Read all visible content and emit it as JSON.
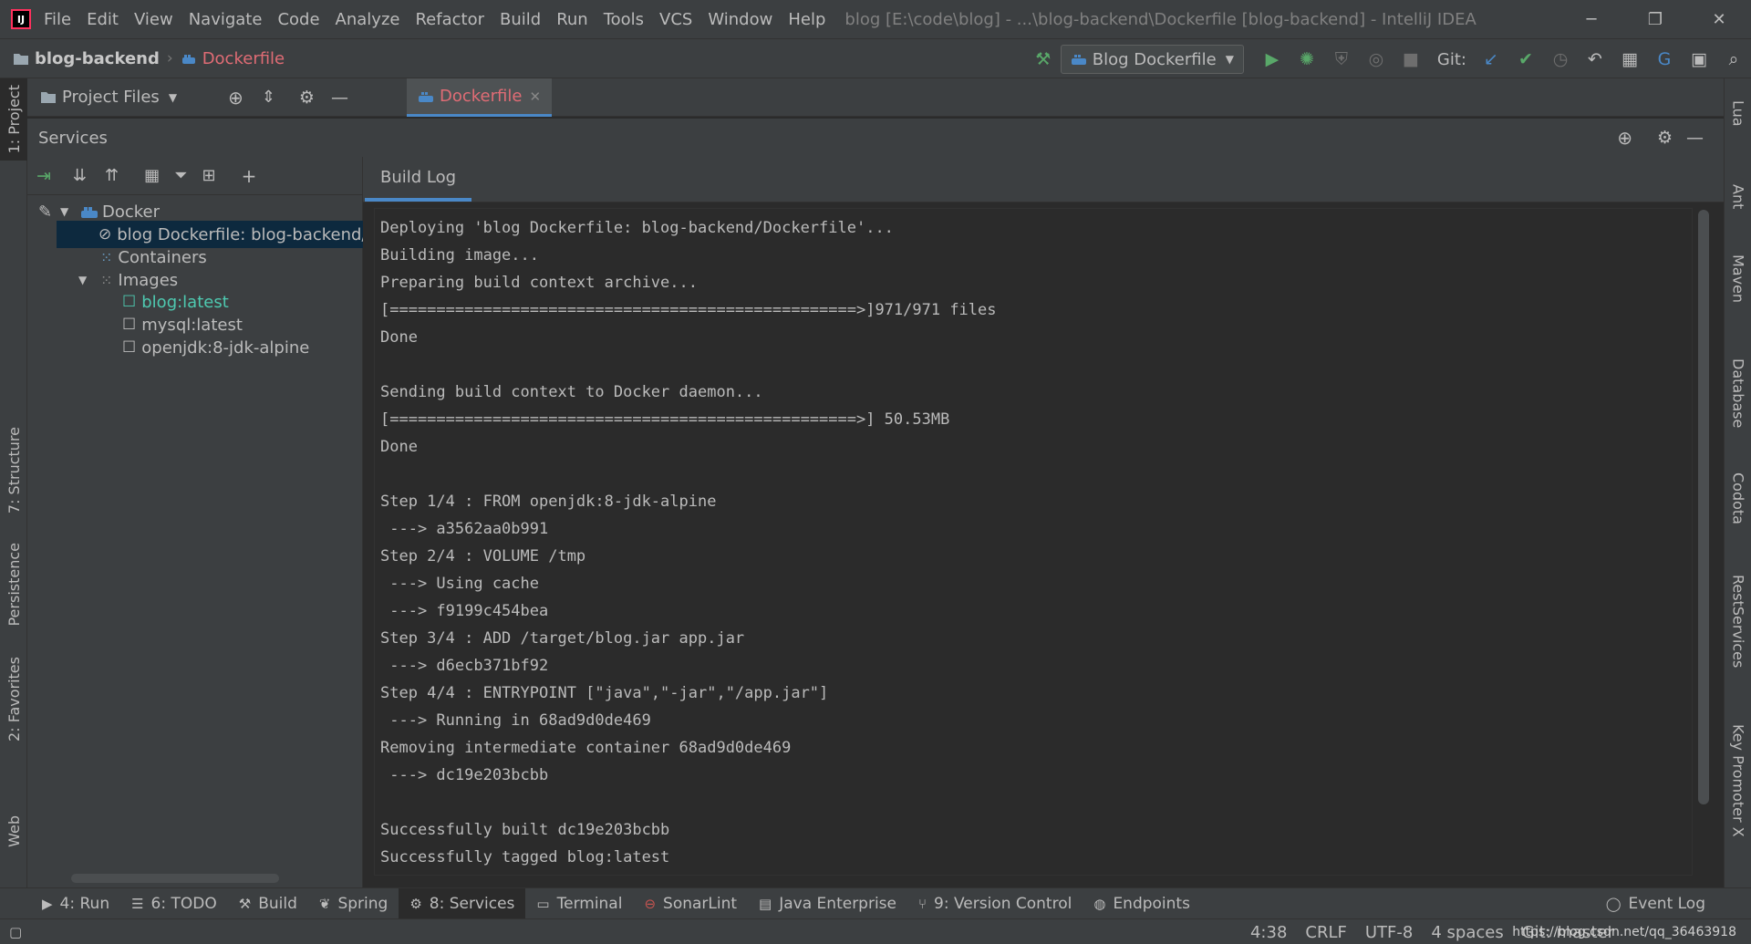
{
  "menubar": {
    "logo_text": "IJ",
    "items": [
      "File",
      "Edit",
      "View",
      "Navigate",
      "Code",
      "Analyze",
      "Refactor",
      "Build",
      "Run",
      "Tools",
      "VCS",
      "Window",
      "Help"
    ],
    "window_title": "blog [E:\\code\\blog] - ...\\blog-backend\\Dockerfile [blog-backend] - IntelliJ IDEA",
    "controls": [
      "─",
      "❐",
      "✕"
    ]
  },
  "navbar": {
    "project": "blog-backend",
    "file": "Dockerfile",
    "run_config": "Blog Dockerfile",
    "git_label": "Git:"
  },
  "project_header": {
    "view_label": "Project Files",
    "file_tab": "Dockerfile"
  },
  "services": {
    "title": "Services",
    "build_log_tab": "Build Log",
    "tree": [
      {
        "label": "Docker",
        "level": 0
      },
      {
        "label": "blog Dockerfile: blog-backend/Dockerfile",
        "level": 1
      },
      {
        "label": "Containers",
        "level": 1
      },
      {
        "label": "Images",
        "level": 1
      },
      {
        "label": "blog:latest",
        "level": 2
      },
      {
        "label": "mysql:latest",
        "level": 2
      },
      {
        "label": "openjdk:8-jdk-alpine",
        "level": 2
      }
    ]
  },
  "log": [
    "Deploying 'blog Dockerfile: blog-backend/Dockerfile'...",
    "Building image...",
    "Preparing build context archive...",
    "[==================================================>]971/971 files",
    "Done",
    "",
    "Sending build context to Docker daemon...",
    "[==================================================>] 50.53MB",
    "Done",
    "",
    "Step 1/4 : FROM openjdk:8-jdk-alpine",
    " ---> a3562aa0b991",
    "Step 2/4 : VOLUME /tmp",
    " ---> Using cache",
    " ---> f9199c454bea",
    "Step 3/4 : ADD /target/blog.jar app.jar",
    " ---> d6ecb371bf92",
    "Step 4/4 : ENTRYPOINT [\"java\",\"-jar\",\"/app.jar\"]",
    " ---> Running in 68ad9d0de469",
    "Removing intermediate container 68ad9d0de469",
    " ---> dc19e203bcbb",
    "",
    "Successfully built dc19e203bcbb",
    "Successfully tagged blog:latest"
  ],
  "left_strip": [
    "1: Project",
    "7: Structure",
    "Persistence",
    "2: Favorites",
    "Web"
  ],
  "right_strip": [
    "Lua",
    "Ant",
    "Maven",
    "Database",
    "Codota",
    "RestServices",
    "Key Promoter X"
  ],
  "bottom_tools": [
    {
      "label": "4: Run",
      "icon": "play-icon"
    },
    {
      "label": "6: TODO",
      "icon": "list-icon"
    },
    {
      "label": "Build",
      "icon": "hammer-icon"
    },
    {
      "label": "Spring",
      "icon": "spring-icon"
    },
    {
      "label": "8: Services",
      "icon": "services-icon"
    },
    {
      "label": "Terminal",
      "icon": "terminal-icon"
    },
    {
      "label": "SonarLint",
      "icon": "sonarlint-icon"
    },
    {
      "label": "Java Enterprise",
      "icon": "java-enterprise-icon"
    },
    {
      "label": "9: Version Control",
      "icon": "version-control-icon"
    },
    {
      "label": "Endpoints",
      "icon": "endpoints-icon"
    }
  ],
  "event_log": "Event Log",
  "status": {
    "position": "4:38",
    "line_sep": "CRLF",
    "encoding": "UTF-8",
    "indent": "4 spaces",
    "git": "Git: master",
    "watermark": "https://blog.csdn.net/qq_36463918"
  },
  "colors": {
    "accent": "#4a88c7",
    "file_red": "#e06c75",
    "image_highlight": "#4ec9b0",
    "run_green": "#59a869"
  }
}
